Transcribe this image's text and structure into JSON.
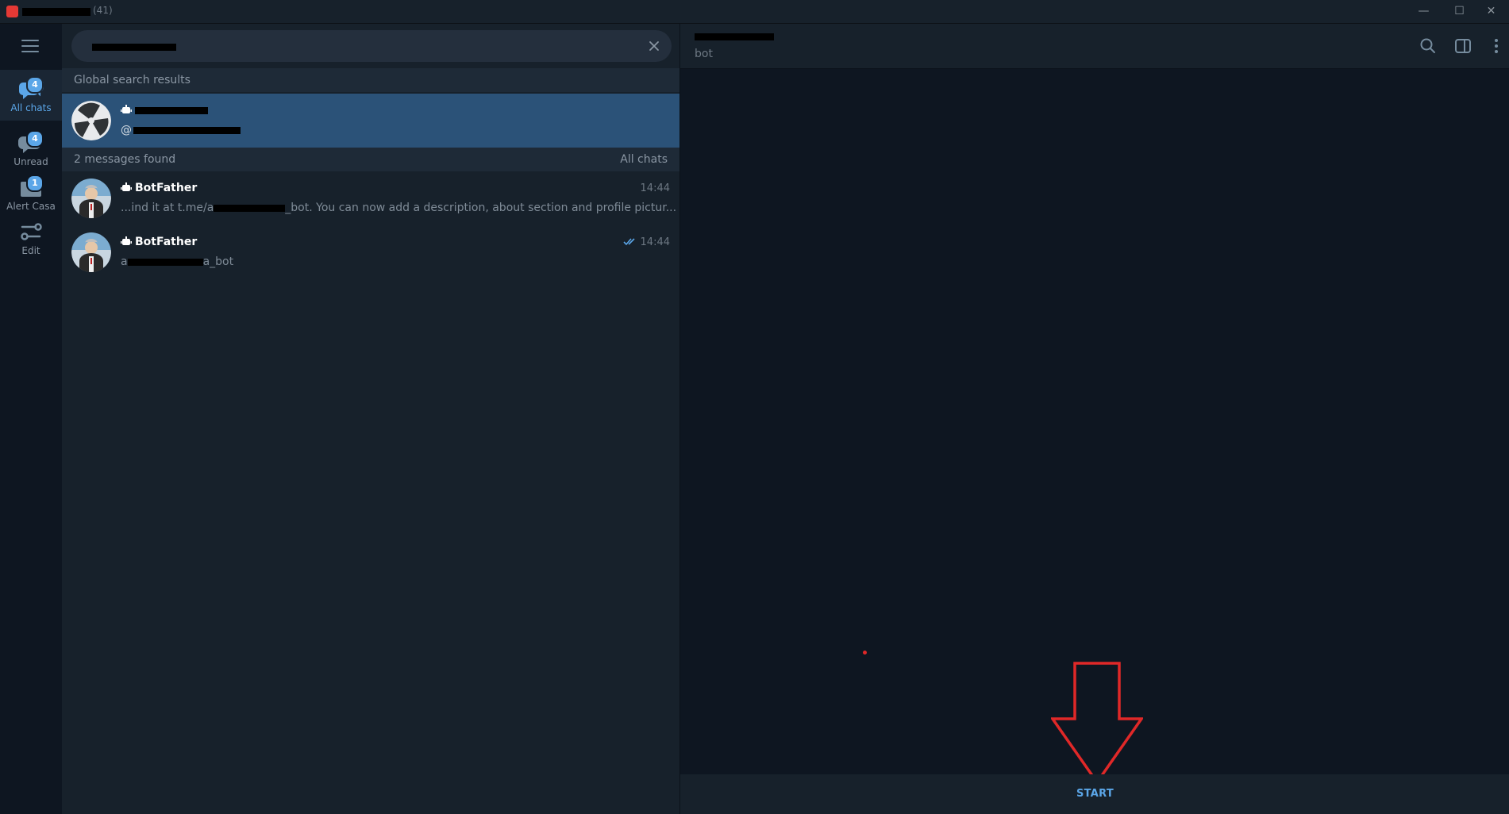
{
  "window": {
    "unread_count": "(41)",
    "controls": {
      "minimize": "—",
      "maximize": "☐",
      "close": "✕"
    }
  },
  "rail": {
    "folders": [
      {
        "label": "All chats",
        "badge": "4",
        "icon": "chats-icon",
        "active": true
      },
      {
        "label": "Unread",
        "badge": "4",
        "icon": "chat-bubble-icon",
        "active": false
      },
      {
        "label": "Alert Casa",
        "badge": "1",
        "icon": "folder-icon",
        "active": false
      },
      {
        "label": "Edit",
        "badge": "",
        "icon": "sliders-icon",
        "active": false
      }
    ]
  },
  "search": {
    "query": "",
    "clear_icon": "close-icon"
  },
  "global_results": {
    "header": "Global search results",
    "items": [
      {
        "username_prefix": "@",
        "selected": true
      }
    ]
  },
  "messages": {
    "header": "2 messages found",
    "filter": "All chats",
    "items": [
      {
        "name": "BotFather",
        "time": "14:44",
        "snippet_start": "...ind it at t.me/a",
        "snippet_end": "_bot. You can now add a description, about section and profile pictur...",
        "read": false
      },
      {
        "name": "BotFather",
        "time": "14:44",
        "snippet_start": "a",
        "snippet_end": "a_bot",
        "read": true
      }
    ]
  },
  "chat": {
    "status": "bot",
    "header_icons": [
      "search-icon",
      "sidebar-toggle-icon",
      "more-vertical-icon"
    ],
    "start_label": "START"
  },
  "colors": {
    "accent": "#5ba6e8",
    "selected": "#2b5278",
    "annotation": "#e02828"
  }
}
